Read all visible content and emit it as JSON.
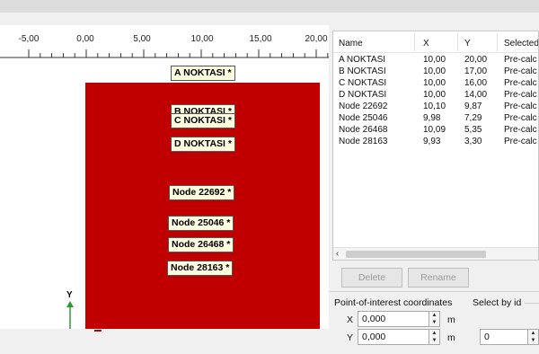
{
  "ruler": {
    "ticks": [
      "-5,00",
      "0,00",
      "5,00",
      "10,00",
      "15,00",
      "20,00"
    ]
  },
  "canvas": {
    "labels": [
      "A NOKTASI *",
      "B NOKTASI *",
      "C NOKTASI *",
      "D NOKTASI *",
      "Node 22692 *",
      "Node 25046 *",
      "Node 26468 *",
      "Node 28163 *"
    ],
    "axis_y": "Y",
    "region_color": "#c00000"
  },
  "table": {
    "headers": [
      "Name",
      "X",
      "Y",
      "Selected"
    ],
    "rows": [
      [
        "A NOKTASI",
        "10,00",
        "20,00",
        "Pre-calc"
      ],
      [
        "B NOKTASI",
        "10,00",
        "17,00",
        "Pre-calc"
      ],
      [
        "C NOKTASI",
        "10,00",
        "16,00",
        "Pre-calc"
      ],
      [
        "D NOKTASI",
        "10,00",
        "14,00",
        "Pre-calc"
      ],
      [
        "Node 22692",
        "10,10",
        "9,87",
        "Pre-calc"
      ],
      [
        "Node 25046",
        "9,98",
        "7,29",
        "Pre-calc"
      ],
      [
        "Node 26468",
        "10,09",
        "5,35",
        "Pre-calc"
      ],
      [
        "Node 28163",
        "9,93",
        "3,30",
        "Pre-calc"
      ]
    ]
  },
  "buttons": {
    "delete": "Delete",
    "rename": "Rename"
  },
  "poi": {
    "title": "Point-of-interest coordinates",
    "x_label": "X",
    "y_label": "Y",
    "x_value": "0,000",
    "y_value": "0,000",
    "unit": "m"
  },
  "select_by_id": {
    "title": "Select by id",
    "value": "0"
  }
}
